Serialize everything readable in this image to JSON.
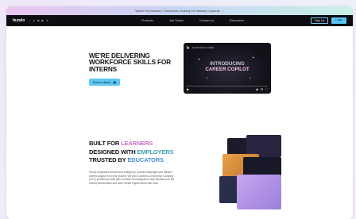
{
  "banner": {
    "text": "Watch On Demand | Connection: Scaling the Intimacy Capacity →"
  },
  "nav": {
    "logo": "hundo",
    "links": [
      "Products",
      "Job Seeks",
      "Contact us",
      "Resources"
    ],
    "signup": "Sign Up",
    "login": "Login"
  },
  "hero": {
    "title": "WE'RE DELIVERING WORKFORCE SKILLS FOR INTERNS",
    "button_label": "Book a demo",
    "video": {
      "channel": "Hundo Career Copilot",
      "title_line1": "INTRODUCING",
      "title_line2": "CAREER COPILOT"
    }
  },
  "section": {
    "line1_prefix": "BUILT FOR",
    "line1_accent": "LEARNERS",
    "line2_prefix": "DESIGNED WITH",
    "line2_accent": "EMPLOYERS",
    "line3_prefix": "TRUSTED BY",
    "line3_accent": "EDUCATORS",
    "body": "Hundo empowers schools and colleges to provide meaningful and efficient careers support for every student. We are a Careers & Enterprise Company (CEC) certified provider with a feature set designed to help educators hit the Gatsby Benchmarks and meet Ofsted requirements with ease."
  },
  "colors": {
    "accent": "#5bc7f4",
    "pink": "#c873c9",
    "teal": "#3fa1b0",
    "nav_bg": "#0d0d12"
  },
  "icons": [
    "tiktok-icon",
    "instagram-icon",
    "linkedin-icon",
    "youtube-icon",
    "x-icon",
    "calendar-icon",
    "play-icon",
    "volume-icon",
    "settings-icon",
    "fullscreen-icon"
  ]
}
